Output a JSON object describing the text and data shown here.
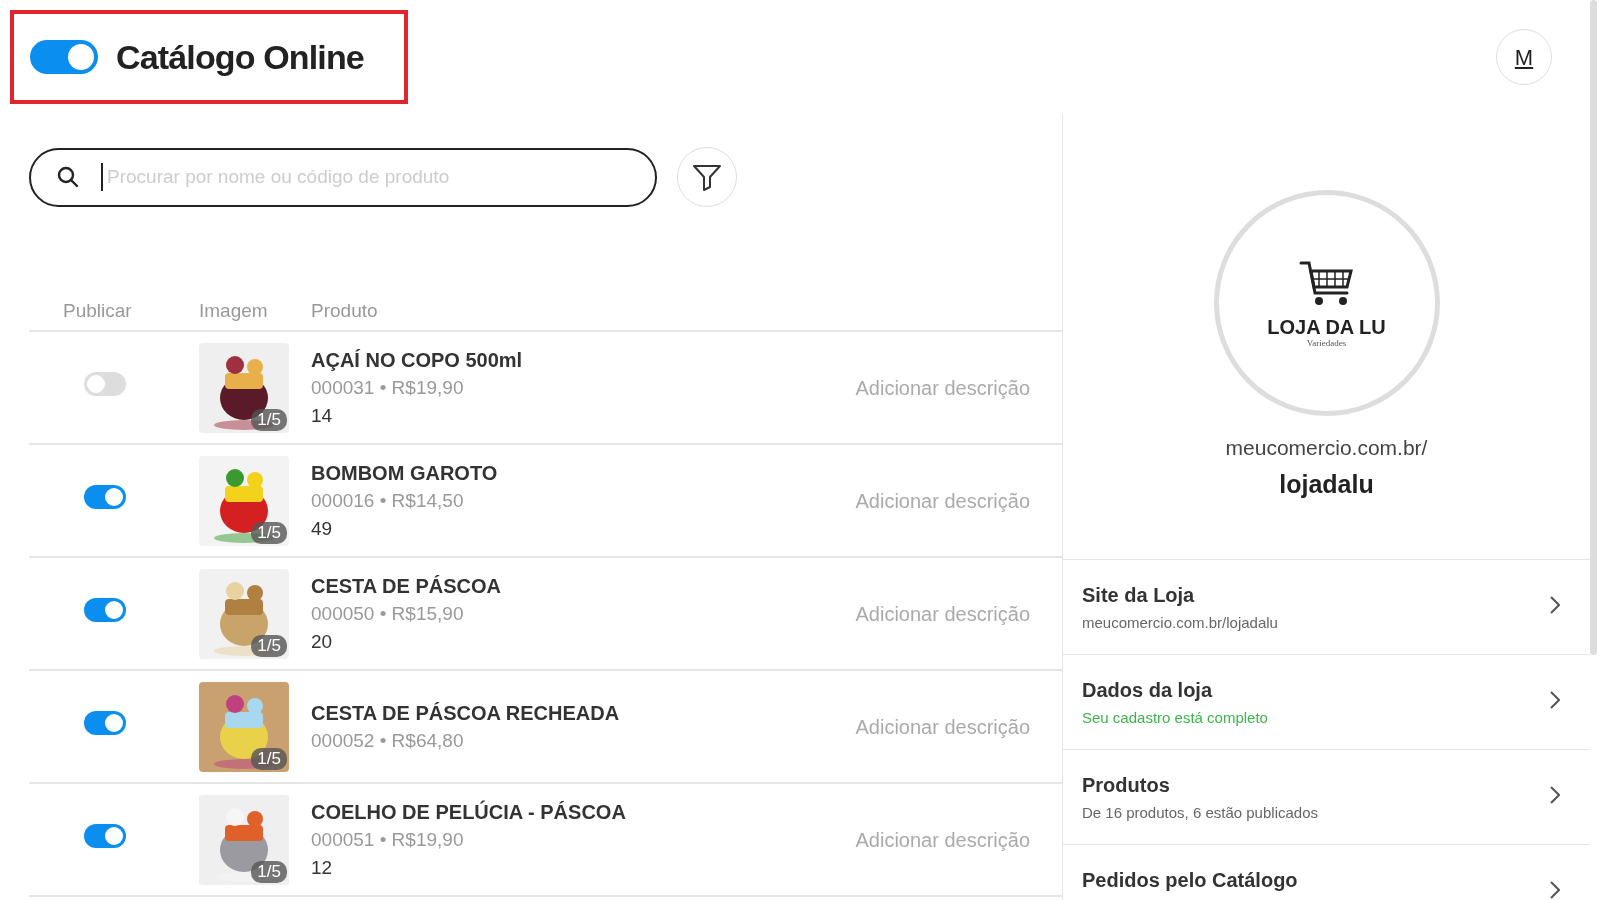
{
  "header": {
    "title": "Catálogo Online",
    "online": true,
    "avatar": "M"
  },
  "search": {
    "placeholder": "Procurar por nome ou código de produto"
  },
  "table": {
    "columns": [
      "Publicar",
      "Imagem",
      "Produto"
    ],
    "rows": [
      {
        "published": false,
        "name": "AÇAÍ NO COPO 500ml",
        "details": "000031 • R$19,90",
        "stock": "14",
        "image_count": "1/5",
        "description": "Adicionar descrição"
      },
      {
        "published": true,
        "name": "BOMBOM GAROTO",
        "details": "000016 • R$14,50",
        "stock": "49",
        "image_count": "1/5",
        "description": "Adicionar descrição"
      },
      {
        "published": true,
        "name": "CESTA DE PÁSCOA",
        "details": "000050 • R$15,90",
        "stock": "20",
        "image_count": "1/5",
        "description": "Adicionar descrição"
      },
      {
        "published": true,
        "name": "CESTA DE PÁSCOA RECHEADA",
        "details": "000052 • R$64,80",
        "image_count": "1/5",
        "description": "Adicionar descrição"
      },
      {
        "published": true,
        "name": "COELHO DE PELÚCIA - PÁSCOA",
        "details": "000051 • R$19,90",
        "stock": "12",
        "image_count": "1/5",
        "description": "Adicionar descrição"
      }
    ]
  },
  "store": {
    "logo_name": "LOJA DA LU",
    "logo_tagline": "Variedades",
    "url_base": "meucomercio.com.br/",
    "slug": "lojadalu",
    "menu": [
      {
        "title": "Site da Loja",
        "subtitle": "meucomercio.com.br/lojadalu",
        "kind": "plain"
      },
      {
        "title": "Dados da loja",
        "subtitle": "Seu cadastro está completo",
        "kind": "success"
      },
      {
        "title": "Produtos",
        "subtitle": "De 16 produtos, 6 estão publicados",
        "kind": "plain"
      },
      {
        "title": "Pedidos pelo Catálogo"
      }
    ]
  }
}
